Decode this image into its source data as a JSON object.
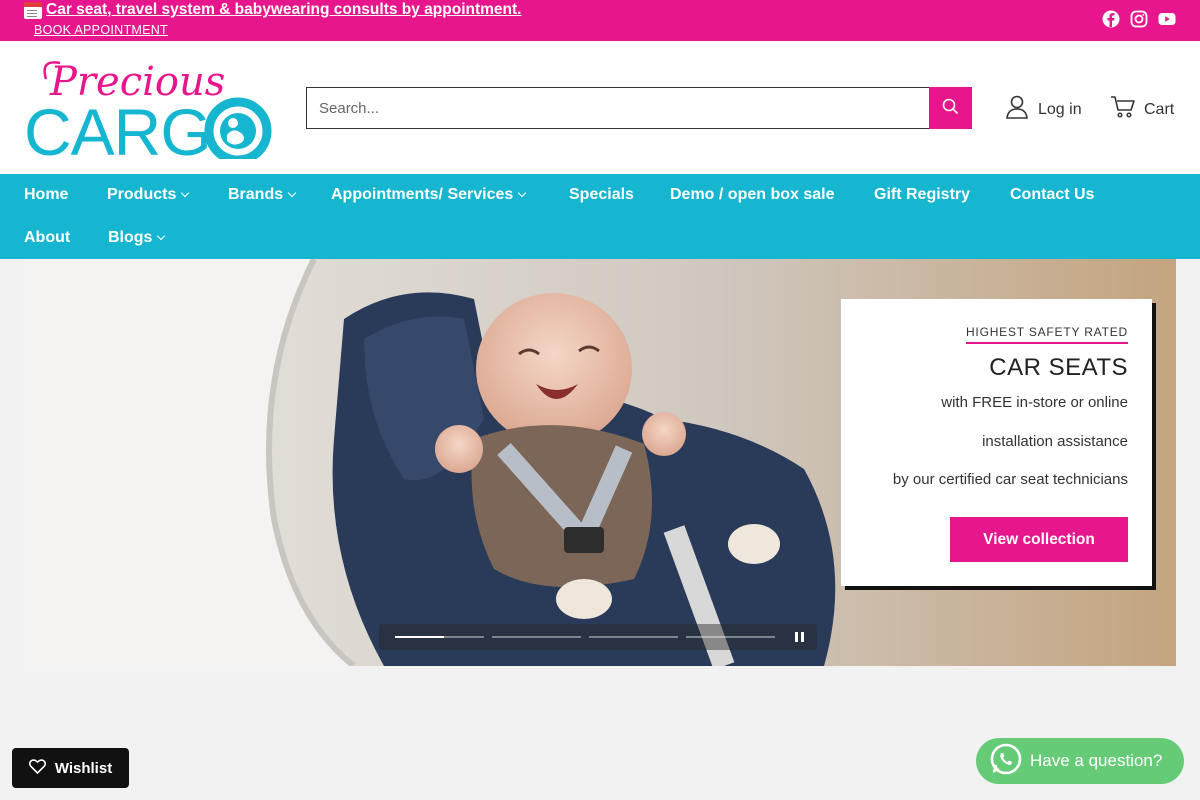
{
  "announcement": {
    "icon": "calendar-icon",
    "text": "Car seat, travel system & babywearing consults by appointment.",
    "book_label": "BOOK APPOINTMENT"
  },
  "social": [
    "facebook-icon",
    "instagram-icon",
    "youtube-icon"
  ],
  "brand": {
    "script": "Precious",
    "word": "CARG",
    "pink": "#e8168c",
    "teal": "#16b5d0"
  },
  "search": {
    "placeholder": "Search..."
  },
  "header": {
    "login_label": "Log in",
    "cart_label": "Cart"
  },
  "nav": {
    "items": [
      {
        "label": "Home",
        "dropdown": false
      },
      {
        "label": "Products",
        "dropdown": true
      },
      {
        "label": "Brands",
        "dropdown": true
      },
      {
        "label": "Appointments/ Services",
        "dropdown": true
      },
      {
        "label": "Specials",
        "dropdown": false
      },
      {
        "label": "Demo / open box sale",
        "dropdown": false
      },
      {
        "label": "Gift Registry",
        "dropdown": false
      },
      {
        "label": "Contact Us",
        "dropdown": false
      },
      {
        "label": "About",
        "dropdown": false
      },
      {
        "label": "Blogs",
        "dropdown": true
      }
    ]
  },
  "hero": {
    "eyebrow": "HIGHEST SAFETY RATED",
    "title": "CAR SEATS",
    "lines": [
      "with FREE in-store or online",
      "installation assistance",
      "by our certified car seat technicians"
    ],
    "button_label": "View collection",
    "slides_count": 4,
    "active_slide_progress": 0.55
  },
  "floating": {
    "wishlist_label": "Wishlist",
    "question_label": "Have a question?"
  }
}
